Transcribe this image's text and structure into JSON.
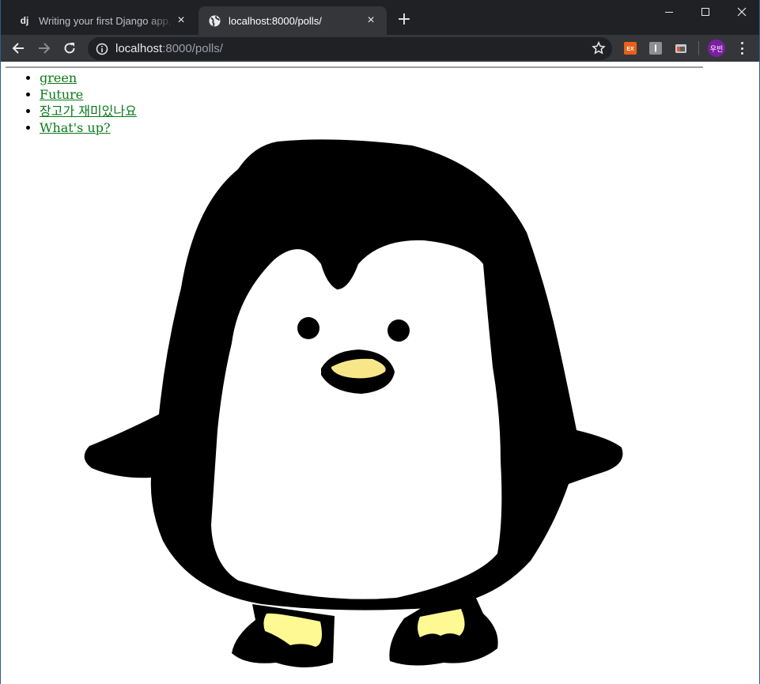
{
  "browser": {
    "tabs": [
      {
        "favicon": "dj",
        "title": "Writing your first Django app, p",
        "active": false
      },
      {
        "favicon": "globe-icon",
        "title": "localhost:8000/polls/",
        "active": true
      }
    ],
    "url_host": "localhost",
    "url_path": ":8000/polls/",
    "profile_initials": "우빈"
  },
  "page": {
    "poll_links": [
      {
        "text": "green"
      },
      {
        "text": "Future"
      },
      {
        "text": "장고가 재미있나요"
      },
      {
        "text": "What's up?"
      }
    ],
    "link_color": "#0a7a1a"
  }
}
